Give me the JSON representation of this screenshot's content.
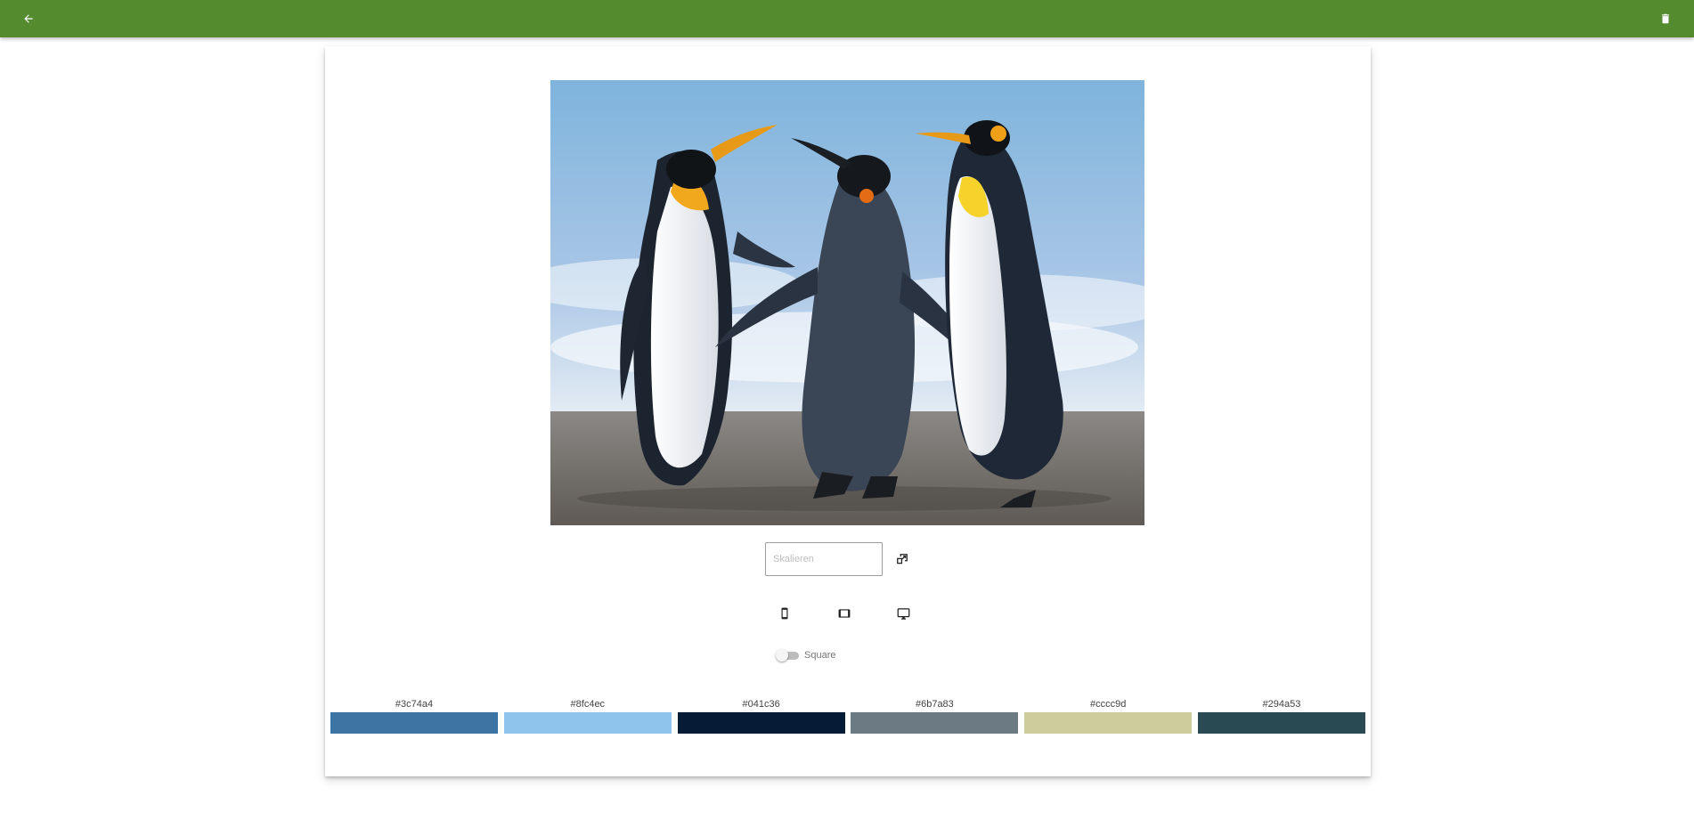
{
  "toolbar": {
    "back_icon": "arrow-left-icon",
    "delete_icon": "trash-icon",
    "color": "#558b2f"
  },
  "image": {
    "subject": "three king penguins on a beach"
  },
  "scale": {
    "placeholder": "Skalieren",
    "value": "",
    "apply_icon": "resize-icon"
  },
  "devices": [
    {
      "icon": "smartphone-icon"
    },
    {
      "icon": "tablet-icon"
    },
    {
      "icon": "desktop-icon"
    }
  ],
  "square_toggle": {
    "label": "Square",
    "checked": false
  },
  "palette": [
    {
      "label": "#3c74a4",
      "color": "#3c74a4"
    },
    {
      "label": "#8fc4ec",
      "color": "#8fc4ec"
    },
    {
      "label": "#041c36",
      "color": "#041c36"
    },
    {
      "label": "#6b7a83",
      "color": "#6b7a83"
    },
    {
      "label": "#cccc9d",
      "color": "#cccc9d"
    },
    {
      "label": "#294a53",
      "color": "#294a53"
    }
  ]
}
